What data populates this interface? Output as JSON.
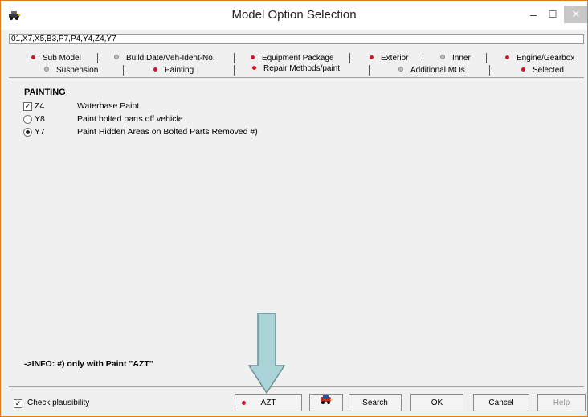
{
  "window": {
    "title": "Model Option Selection",
    "min_glyph": "–",
    "max_glyph": "☐",
    "close_glyph": "✕"
  },
  "code_field": {
    "value": "01,X7,X5,B3,P7,P4,Y4,Z4,Y7"
  },
  "tabs_row1": [
    {
      "label": "Sub Model",
      "dot": "red"
    },
    {
      "label": "Build Date/Veh-Ident-No.",
      "dot": "grey"
    },
    {
      "label": "Equipment Package",
      "dot": "red"
    },
    {
      "label": "Exterior",
      "dot": "red"
    },
    {
      "label": "Inner",
      "dot": "grey"
    },
    {
      "label": "Engine/Gearbox",
      "dot": "red"
    }
  ],
  "tabs_row2": [
    {
      "label": "Suspension",
      "dot": "grey"
    },
    {
      "label": "Painting",
      "dot": "red"
    },
    {
      "label": "Repair Methods/paint",
      "dot": "red",
      "active": true
    },
    {
      "label": "Additional MOs",
      "dot": "grey"
    },
    {
      "label": "Selected",
      "dot": "red"
    }
  ],
  "painting": {
    "title": "PAINTING",
    "options": [
      {
        "control": "checkbox",
        "checked": true,
        "code": "Z4",
        "label": "Waterbase Paint"
      },
      {
        "control": "radio",
        "checked": false,
        "code": "Y8",
        "label": "Paint bolted parts off vehicle"
      },
      {
        "control": "radio",
        "checked": true,
        "code": "Y7",
        "label": "Paint Hidden Areas on Bolted Parts Removed #)"
      }
    ],
    "info": "->INFO:  #) only with Paint \"AZT\""
  },
  "bottom": {
    "check_plausibility": {
      "label": "Check plausibility",
      "checked": true
    },
    "buttons": {
      "azt": "AZT",
      "search": "Search",
      "ok": "OK",
      "cancel": "Cancel",
      "help": "Help"
    }
  },
  "colors": {
    "window_border": "#e07a1a",
    "status_red": "#d0162a",
    "status_grey": "#b9b9b9",
    "annotation_arrow": "#a9d3d6"
  }
}
